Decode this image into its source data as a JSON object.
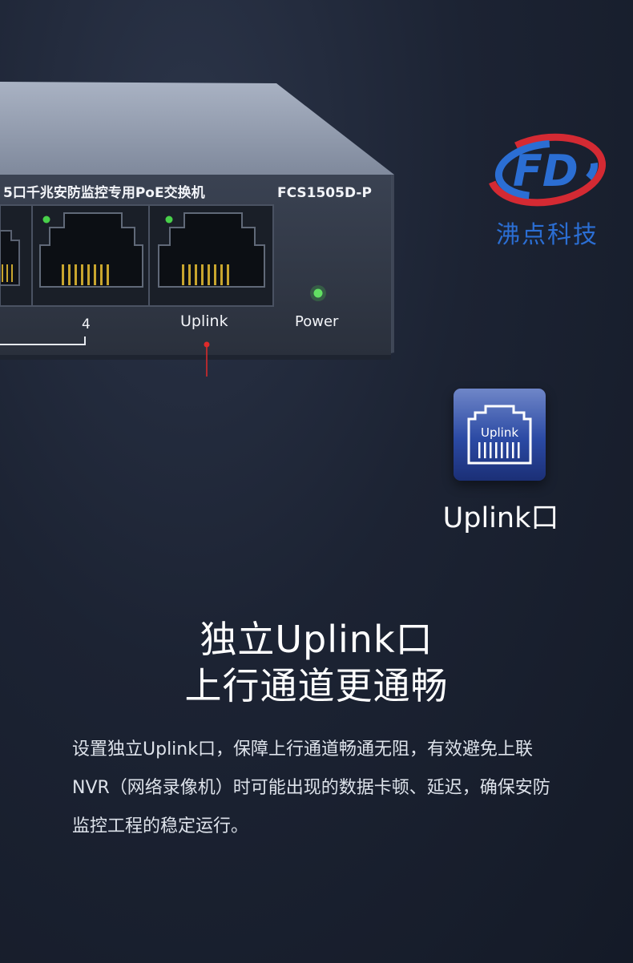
{
  "device": {
    "panel_title": "5口千兆安防监控专用PoE交换机",
    "model": "FCS1505D-P",
    "port_number_label": "4",
    "uplink_label": "Uplink",
    "power_label": "Power"
  },
  "brand": {
    "logo_text": "FD",
    "name": "沸点科技"
  },
  "callout": {
    "tile_label": "Uplink",
    "caption": "Uplink口"
  },
  "headline": {
    "line1": "独立Uplink口",
    "line2": "上行通道更通畅"
  },
  "description": "设置独立Uplink口，保障上行通道畅通无阻，有效避免上联NVR（网络录像机）时可能出现的数据卡顿、延迟，确保安防监控工程的稳定运行。",
  "colors": {
    "background": "#1c2333",
    "accent_red": "#e02a2a",
    "led_green": "#48d04a",
    "brand_blue": "#2b6ed3"
  }
}
